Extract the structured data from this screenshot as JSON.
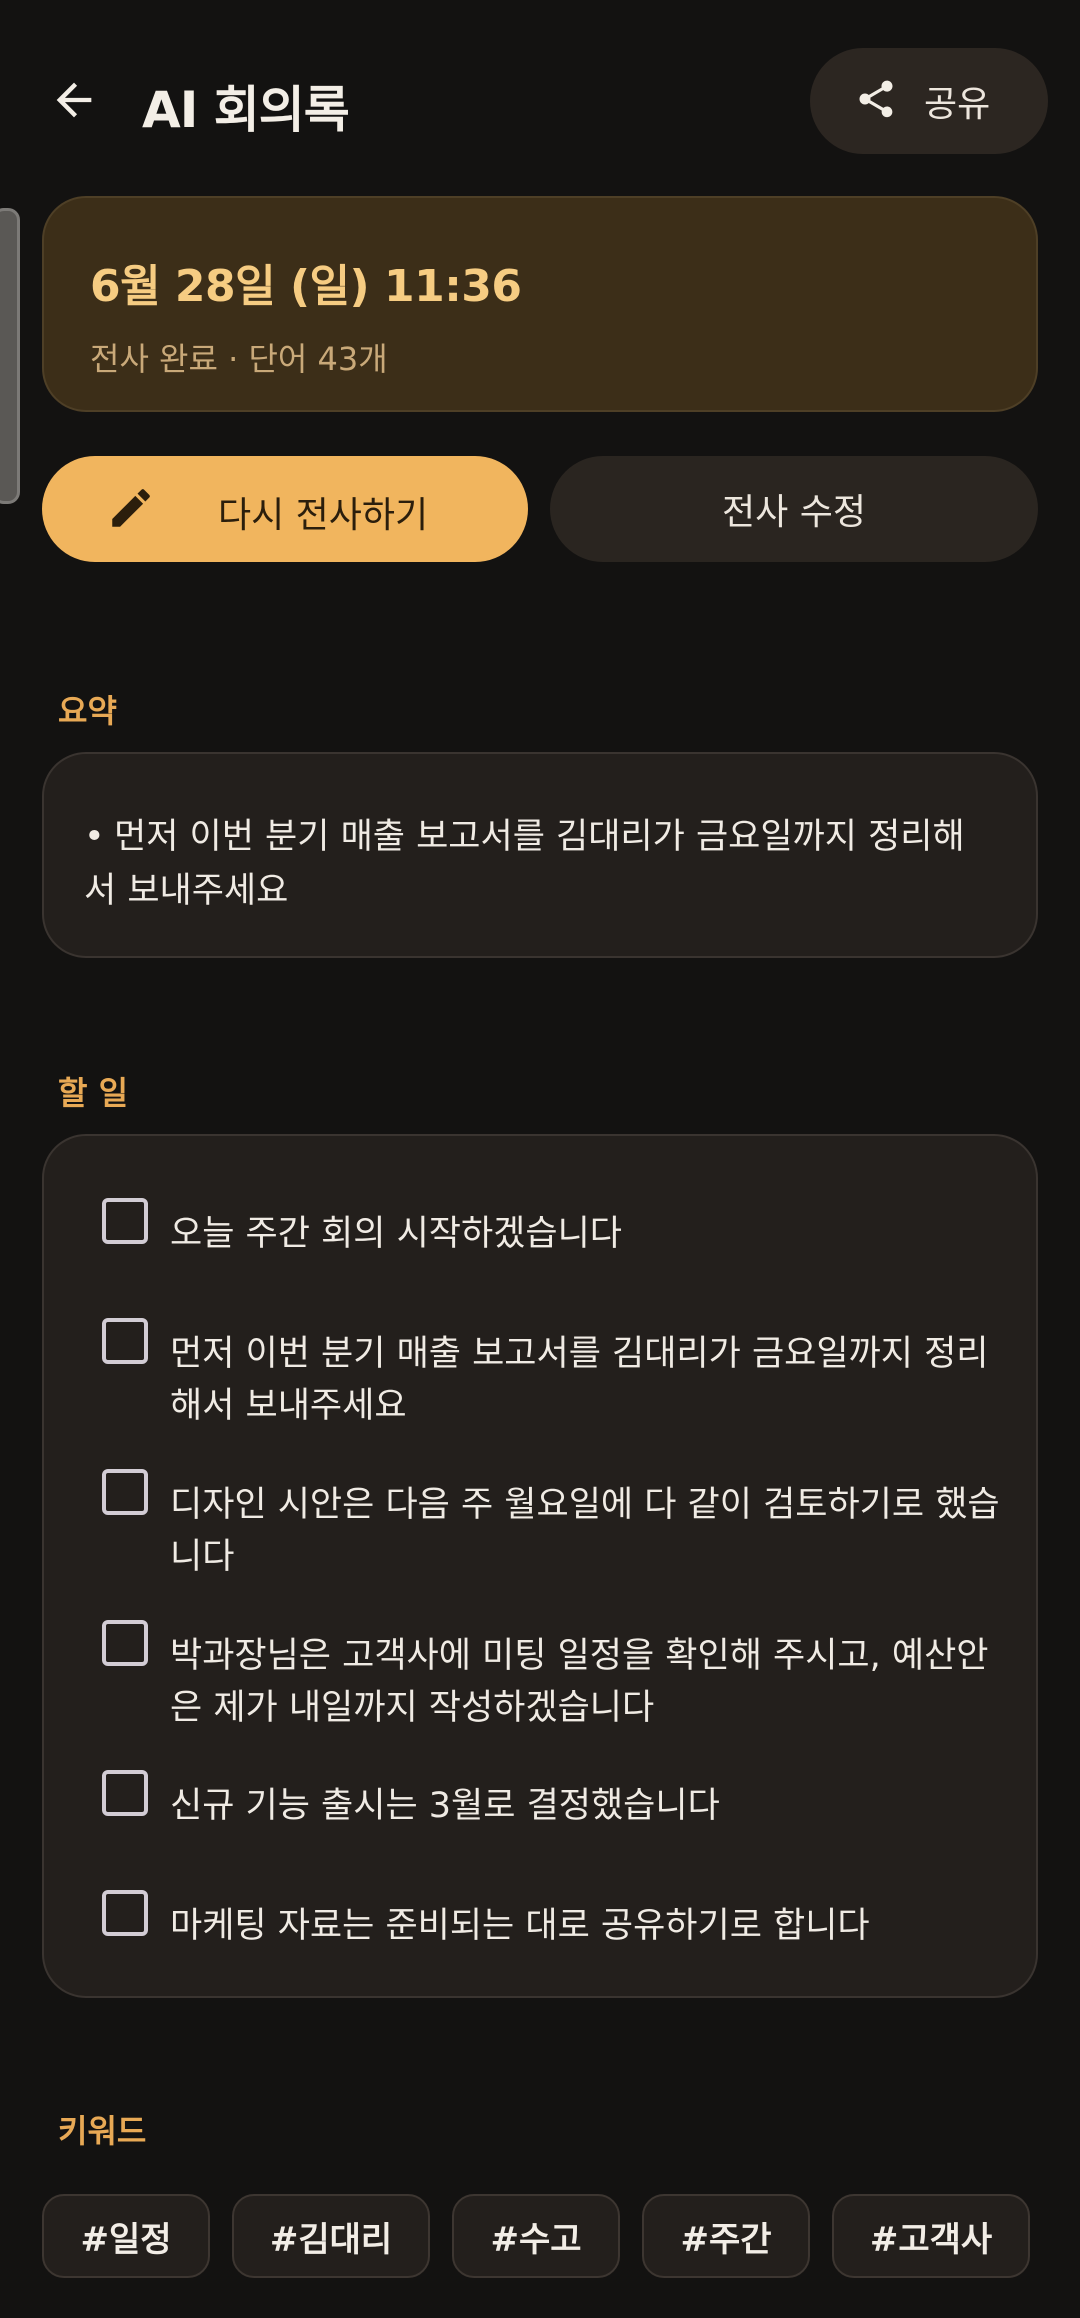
{
  "header": {
    "title": "AI 회의록",
    "share_label": "공유"
  },
  "date_card": {
    "title": "6월 28일 (일) 11:36",
    "subtitle": "전사 완료 · 단어 43개"
  },
  "actions": {
    "retranscribe_label": "다시 전사하기",
    "edit_label": "전사 수정"
  },
  "summary": {
    "heading": "요약",
    "bullet": "•",
    "items": [
      "먼저 이번 분기 매출 보고서를 김대리가 금요일까지 정리해서 보내주세요"
    ]
  },
  "todos": {
    "heading": "할 일",
    "items": [
      {
        "text": "오늘 주간 회의 시작하겠습니다",
        "checked": false
      },
      {
        "text": "먼저 이번 분기 매출 보고서를 김대리가 금요일까지 정리해서 보내주세요",
        "checked": false
      },
      {
        "text": "디자인 시안은 다음 주 월요일에 다 같이 검토하기로 했습니다",
        "checked": false
      },
      {
        "text": "박과장님은 고객사에 미팅 일정을 확인해 주시고, 예산안은 제가 내일까지 작성하겠습니다",
        "checked": false
      },
      {
        "text": "신규 기능 출시는 3월로 결정했습니다",
        "checked": false
      },
      {
        "text": "마케팅 자료는 준비되는 대로 공유하기로 합니다",
        "checked": false
      }
    ]
  },
  "keywords": {
    "heading": "키워드",
    "items": [
      "#일정",
      "#김대리",
      "#수고",
      "#주간",
      "#고객사"
    ]
  },
  "icons": {
    "back": "arrow-left-icon",
    "share": "share-icon",
    "retranscribe": "pencil-icon"
  },
  "colors": {
    "background": "#131211",
    "accent": "#F1B55E",
    "date_card": "#3C2E18",
    "section_heading": "#E8A955",
    "card": "#231F1C"
  }
}
